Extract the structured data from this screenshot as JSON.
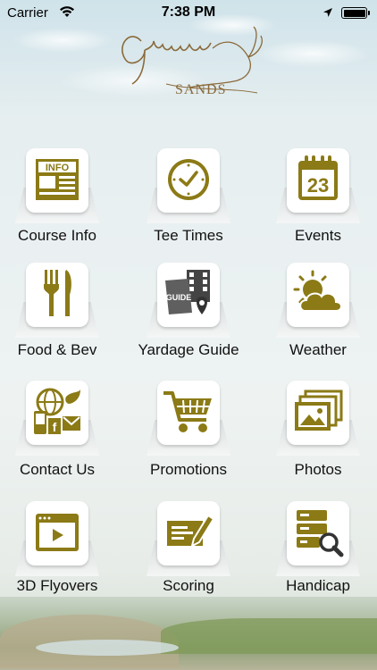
{
  "status_bar": {
    "carrier": "Carrier",
    "time": "7:38 PM"
  },
  "logo": {
    "sands": "SANDS"
  },
  "colors": {
    "accent_gold": "#8b7a16",
    "card_bg": "#ffffff"
  },
  "menu": [
    {
      "label": "Course Info",
      "icon": "info-newspaper-icon",
      "icon_text": "INFO"
    },
    {
      "label": "Tee Times",
      "icon": "clock-icon"
    },
    {
      "label": "Events",
      "icon": "calendar-icon",
      "icon_text": "23"
    },
    {
      "label": "Food & Bev",
      "icon": "fork-knife-icon"
    },
    {
      "label": "Yardage Guide",
      "icon": "guide-map-icon",
      "icon_text": "GUIDE"
    },
    {
      "label": "Weather",
      "icon": "sun-cloud-icon"
    },
    {
      "label": "Contact Us",
      "icon": "contact-icon"
    },
    {
      "label": "Promotions",
      "icon": "shopping-cart-icon"
    },
    {
      "label": "Photos",
      "icon": "photos-icon"
    },
    {
      "label": "3D Flyovers",
      "icon": "video-play-icon"
    },
    {
      "label": "Scoring",
      "icon": "scorecard-pen-icon"
    },
    {
      "label": "Handicap",
      "icon": "handicap-search-icon"
    }
  ]
}
